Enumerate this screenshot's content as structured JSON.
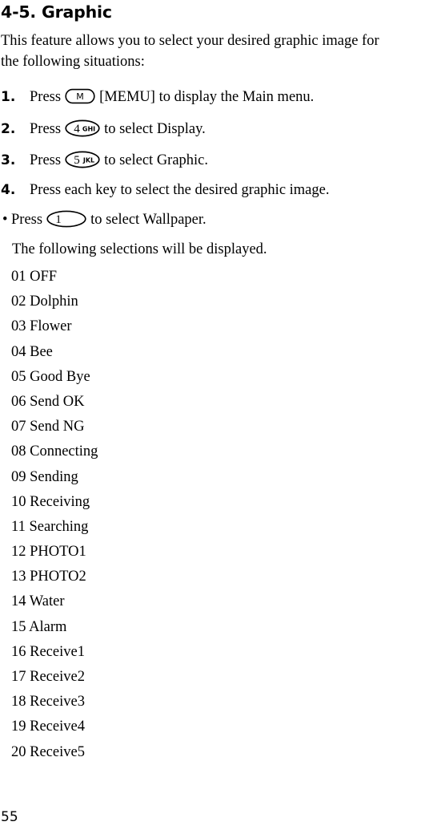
{
  "document": {
    "heading": "4-5. Graphic",
    "page_number": "55"
  },
  "intro": {
    "line1": "This feature allows you to select your desired graphic image for",
    "line2": "the following situations:"
  },
  "steps": [
    {
      "num": "1.",
      "text_before": "Press",
      "key": {
        "type": "stadium",
        "digit": "",
        "letters": "",
        "label": "M"
      },
      "text_after": "[MEMU] to display the Main menu."
    },
    {
      "num": "2.",
      "text_before": "Press",
      "key": {
        "type": "ellipse",
        "digit": "4",
        "letters": "GHI",
        "label": ""
      },
      "text_after": "to select Display."
    },
    {
      "num": "3.",
      "text_before": "Press",
      "key": {
        "type": "ellipse",
        "digit": "5",
        "letters": "JKL",
        "label": ""
      },
      "text_after": "to select Graphic."
    },
    {
      "num": "4.",
      "text_before": "Press each key to select the desired graphic image.",
      "key": null,
      "text_after": ""
    }
  ],
  "bullet": {
    "marker": "•",
    "text_before": "Press",
    "key": {
      "type": "ellipse-wide",
      "digit": "1",
      "letters": "",
      "label": ""
    },
    "text_after": "to select Wallpaper."
  },
  "subnote": "The following selections will be displayed.",
  "selections": [
    {
      "num": "01",
      "label": "OFF"
    },
    {
      "num": "02",
      "label": "Dolphin"
    },
    {
      "num": "03",
      "label": "Flower"
    },
    {
      "num": "04",
      "label": "Bee"
    },
    {
      "num": "05",
      "label": "Good Bye"
    },
    {
      "num": "06",
      "label": "Send OK"
    },
    {
      "num": "07",
      "label": "Send NG"
    },
    {
      "num": "08",
      "label": "Connecting"
    },
    {
      "num": "09",
      "label": "Sending"
    },
    {
      "num": "10",
      "label": "Receiving"
    },
    {
      "num": "11",
      "label": "Searching"
    },
    {
      "num": "12",
      "label": "PHOTO1"
    },
    {
      "num": "13",
      "label": "PHOTO2"
    },
    {
      "num": "14",
      "label": "Water"
    },
    {
      "num": "15",
      "label": "Alarm"
    },
    {
      "num": "16",
      "label": "Receive1"
    },
    {
      "num": "17",
      "label": "Receive2"
    },
    {
      "num": "18",
      "label": "Receive3"
    },
    {
      "num": "19",
      "label": "Receive4"
    },
    {
      "num": "20",
      "label": "Receive5"
    }
  ],
  "colors": {
    "background": "#ffffff",
    "text": "#000000"
  }
}
